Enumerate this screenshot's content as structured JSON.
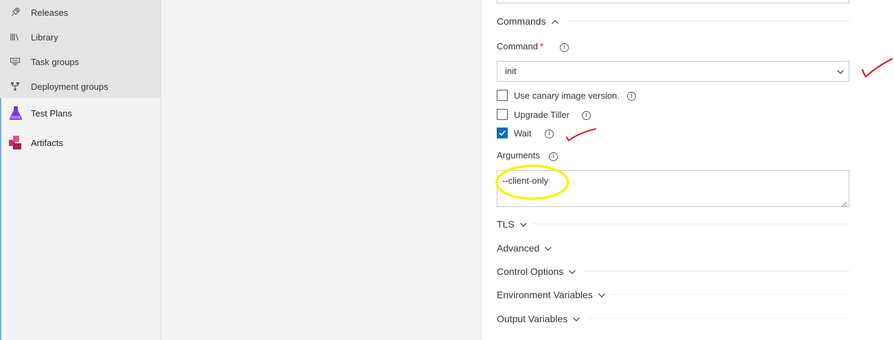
{
  "sidebar": {
    "sub_items": [
      {
        "label": "Releases",
        "icon": "rocket-icon"
      },
      {
        "label": "Library",
        "icon": "library-icon"
      },
      {
        "label": "Task groups",
        "icon": "task-groups-icon"
      },
      {
        "label": "Deployment groups",
        "icon": "deployment-groups-icon"
      }
    ],
    "hubs": [
      {
        "label": "Test Plans",
        "icon": "test-plans-icon",
        "color": "#773adc"
      },
      {
        "label": "Artifacts",
        "icon": "artifacts-icon",
        "color": "#cc2e6c"
      }
    ]
  },
  "panel": {
    "commands_section": {
      "label": "Commands",
      "expanded": true
    },
    "command": {
      "label": "Command",
      "required_mark": "*",
      "value": "init"
    },
    "checkboxes": [
      {
        "label": "Use canary image version.",
        "checked": false
      },
      {
        "label": "Upgrade Tiller",
        "checked": false
      },
      {
        "label": "Wait",
        "checked": true
      }
    ],
    "arguments": {
      "label": "Arguments",
      "value": "--client-only"
    },
    "sections": [
      {
        "label": "TLS",
        "expanded": false
      },
      {
        "label": "Advanced",
        "expanded": false
      },
      {
        "label": "Control Options",
        "expanded": false
      },
      {
        "label": "Environment Variables",
        "expanded": false
      },
      {
        "label": "Output Variables",
        "expanded": false
      }
    ]
  },
  "colors": {
    "accent": "#0078d4",
    "checkbox_checked": "#106ebe",
    "required": "#c50f1f",
    "annotation_red": "#e8141c",
    "annotation_yellow": "#f5f500"
  }
}
